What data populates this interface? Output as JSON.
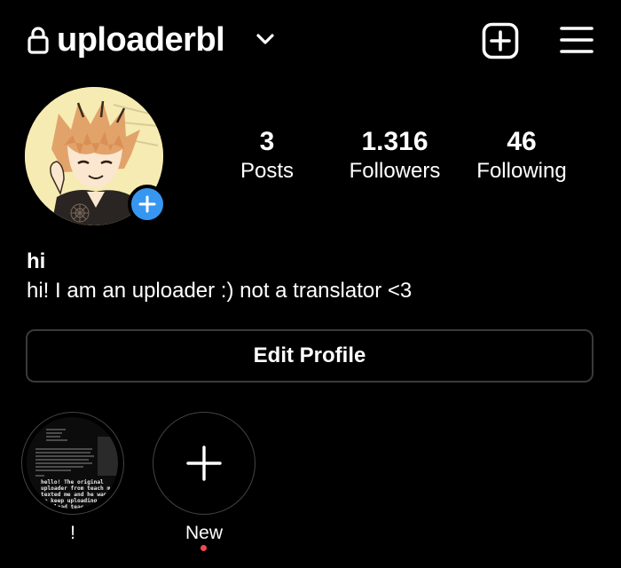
{
  "header": {
    "username": "uploaderbl",
    "lock_icon": "lock-icon",
    "chevron_icon": "chevron-down-icon",
    "new_post_icon": "plus-square-icon",
    "menu_icon": "hamburger-menu-icon"
  },
  "profile": {
    "avatar": "anime-character-avatar",
    "add_story_icon": "plus-icon",
    "accent_color": "#3797f0",
    "stats": [
      {
        "count": "3",
        "label": "Posts"
      },
      {
        "count": "1.316",
        "label": "Followers"
      },
      {
        "count": "46",
        "label": "Following"
      }
    ]
  },
  "bio": {
    "name": "hi",
    "text": "hi! I am an uploader :) not a translator <3"
  },
  "edit_profile": {
    "label": "Edit Profile"
  },
  "highlights": [
    {
      "label": "!",
      "cover_text": "hello! The original\nuploader from teach me\ntexted me and he wante\nto keep uploading a\n  upload teac"
    },
    {
      "label": "New",
      "icon": "plus-icon",
      "indicator_color": "#f04a4a"
    }
  ]
}
